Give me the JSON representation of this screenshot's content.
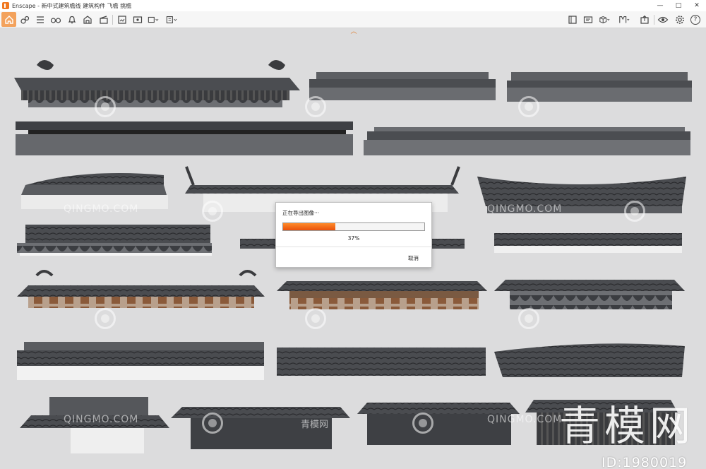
{
  "window": {
    "app_name": "Enscape",
    "title": "Enscape - 新中式建筑檐线 建筑构件 飞檐 挑檐",
    "controls": {
      "minimize": "—",
      "maximize": "□",
      "close": "✕"
    }
  },
  "toolbar": {
    "left_icons": [
      "home-icon",
      "render-icon",
      "settings-list-icon",
      "glasses-icon",
      "bell-icon",
      "house-icon",
      "clapperboard-icon",
      "screenshot-icon",
      "panorama-icon",
      "batch-export-icon",
      "standalone-export-icon"
    ],
    "right_icons": [
      "asset-library-icon",
      "capture-icon",
      "cube-icon",
      "material-icon",
      "upload-icon",
      "view-icon",
      "gear-icon",
      "help-icon"
    ],
    "help_label": "?"
  },
  "dialog": {
    "title": "正在导出图像···",
    "progress": 0.37,
    "percent_label": "37%",
    "cancel_label": "取消"
  },
  "watermark": {
    "site_en": "QINGMO.COM",
    "site_cn": "青模网",
    "brand": "青模网",
    "id_label": "ID:1980019"
  },
  "colors": {
    "accent": "#f07820",
    "progress_start": "#ff8c2a",
    "progress_end": "#e8510c",
    "viewport_bg": "#dcdcdd",
    "roof_dark": "#3d3f42",
    "bracket_brown": "#8a5a3a"
  }
}
